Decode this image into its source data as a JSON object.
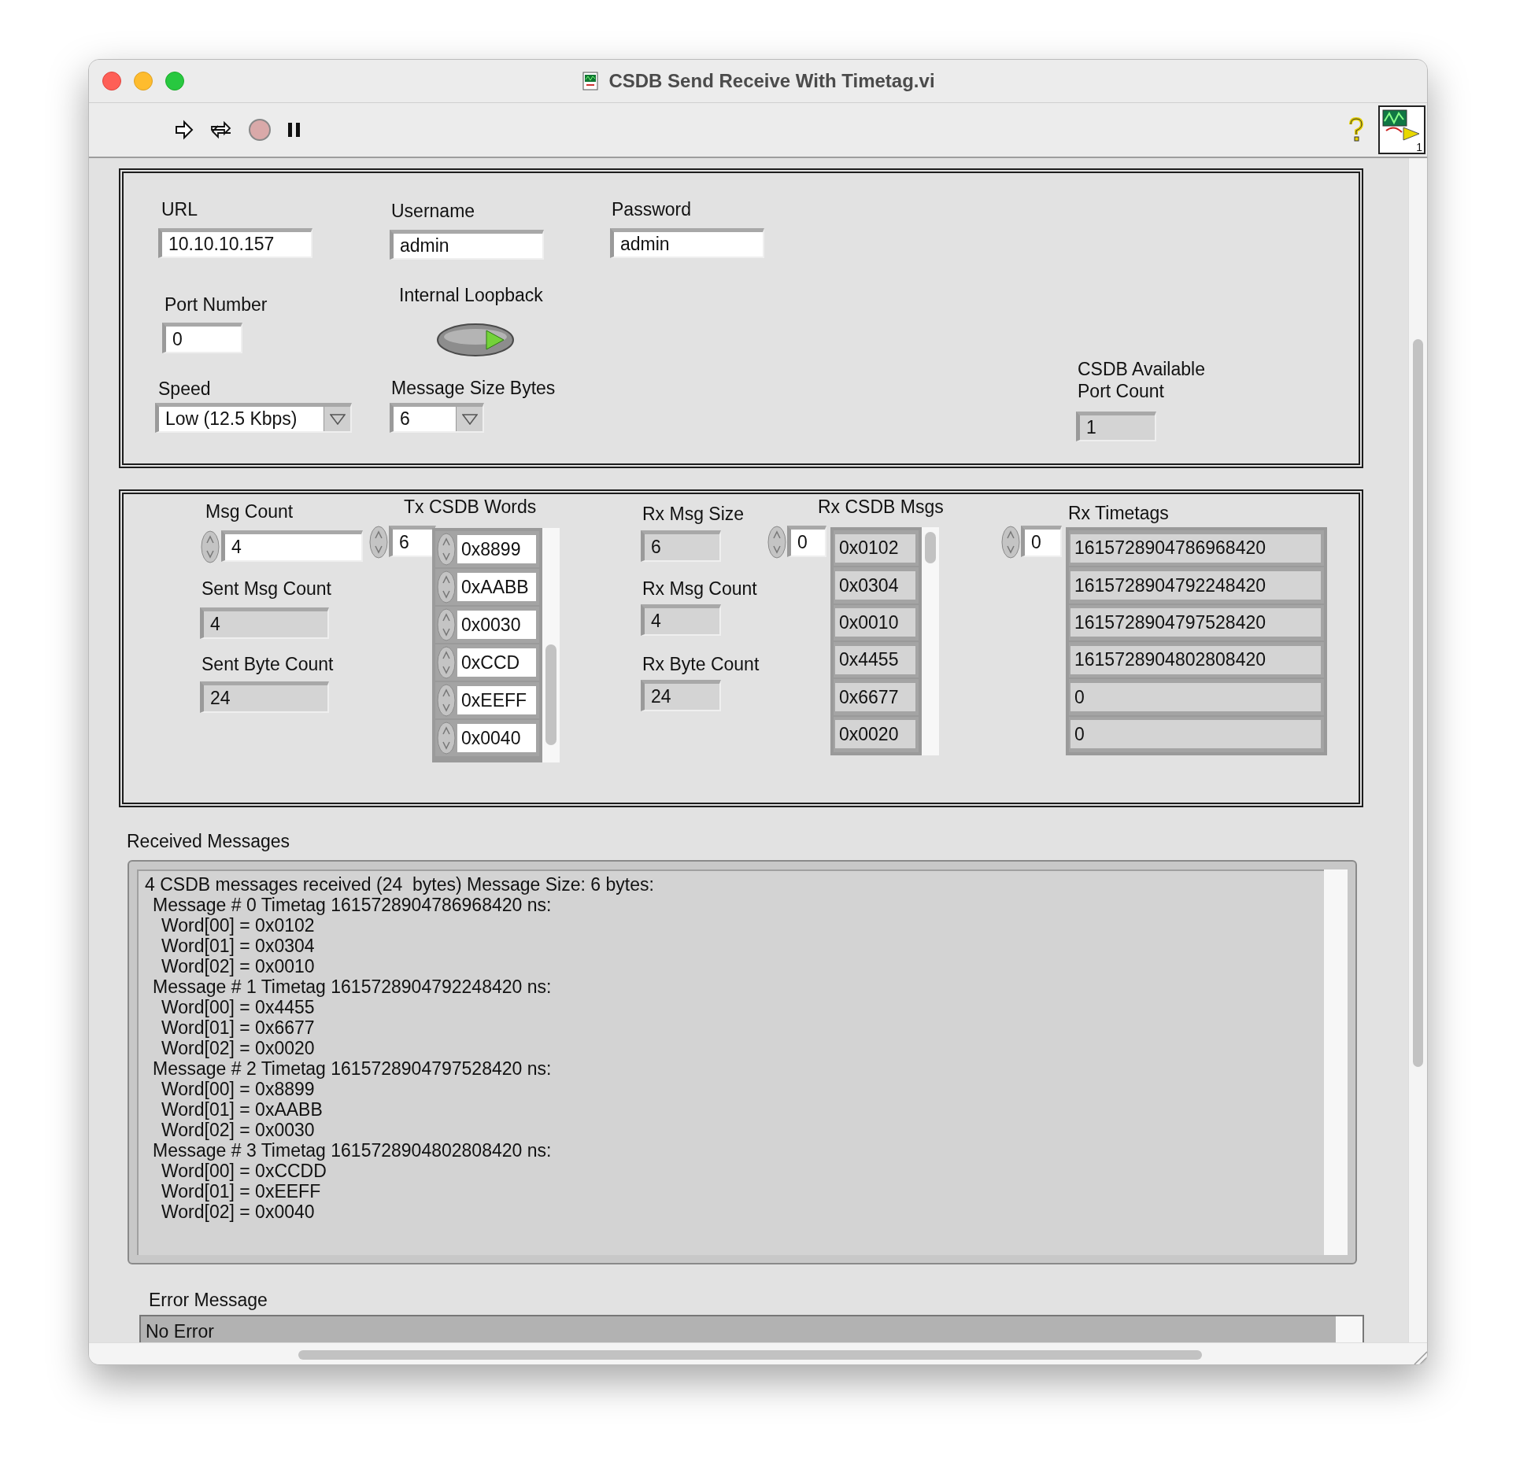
{
  "window": {
    "title": "CSDB Send Receive With Timetag.vi"
  },
  "vi_icon": {
    "number": "1"
  },
  "toolbar": {
    "abort_enabled": false
  },
  "url": {
    "label": "URL",
    "value": "10.10.10.157"
  },
  "username": {
    "label": "Username",
    "value": "admin"
  },
  "password": {
    "label": "Password",
    "value": "admin"
  },
  "port_number": {
    "label": "Port Number",
    "value": "0"
  },
  "internal_loopback": {
    "label": "Internal Loopback",
    "on": true
  },
  "speed": {
    "label": "Speed",
    "value": "Low (12.5 Kbps)"
  },
  "message_size": {
    "label": "Message Size Bytes",
    "value": "6"
  },
  "port_count": {
    "label": "CSDB Available Port Count",
    "value": "1"
  },
  "msg_count": {
    "label": "Msg Count",
    "value": "4"
  },
  "sent_msg_count": {
    "label": "Sent Msg Count",
    "value": "4"
  },
  "sent_byte_count": {
    "label": "Sent Byte Count",
    "value": "24"
  },
  "tx_words": {
    "label": "Tx CSDB Words",
    "index": "6",
    "items": [
      "0x8899",
      "0xAABB",
      "0x0030",
      "0xCCD",
      "0xEEFF",
      "0x0040"
    ]
  },
  "rx_msg_size": {
    "label": "Rx Msg Size",
    "value": "6"
  },
  "rx_msg_count": {
    "label": "Rx Msg Count",
    "value": "4"
  },
  "rx_byte_count": {
    "label": "Rx Byte Count",
    "value": "24"
  },
  "rx_msgs": {
    "label": "Rx CSDB Msgs",
    "index": "0",
    "items": [
      "0x0102",
      "0x0304",
      "0x0010",
      "0x4455",
      "0x6677",
      "0x0020"
    ]
  },
  "rx_timetags": {
    "label": "Rx Timetags",
    "index": "0",
    "items": [
      "1615728904786968420",
      "1615728904792248420",
      "1615728904797528420",
      "1615728904802808420",
      "0",
      "0"
    ]
  },
  "received_messages": {
    "label": "Received Messages",
    "header": "4 CSDB messages received (24  bytes) Message Size: 6 bytes:",
    "messages": [
      {
        "text": "Message # 0 Timetag 1615728904786968420 ns:",
        "words": [
          "Word[00] = 0x0102",
          "Word[01] = 0x0304",
          "Word[02] = 0x0010"
        ]
      },
      {
        "text": "Message # 1 Timetag 1615728904792248420 ns:",
        "words": [
          "Word[00] = 0x4455",
          "Word[01] = 0x6677",
          "Word[02] = 0x0020"
        ]
      },
      {
        "text": "Message # 2 Timetag 1615728904797528420 ns:",
        "words": [
          "Word[00] = 0x8899",
          "Word[01] = 0xAABB",
          "Word[02] = 0x0030"
        ]
      },
      {
        "text": "Message # 3 Timetag 1615728904802808420 ns:",
        "words": [
          "Word[00] = 0xCCDD",
          "Word[01] = 0xEEFF",
          "Word[02] = 0x0040"
        ]
      }
    ]
  },
  "error_message": {
    "label": "Error Message",
    "value": "No Error"
  }
}
